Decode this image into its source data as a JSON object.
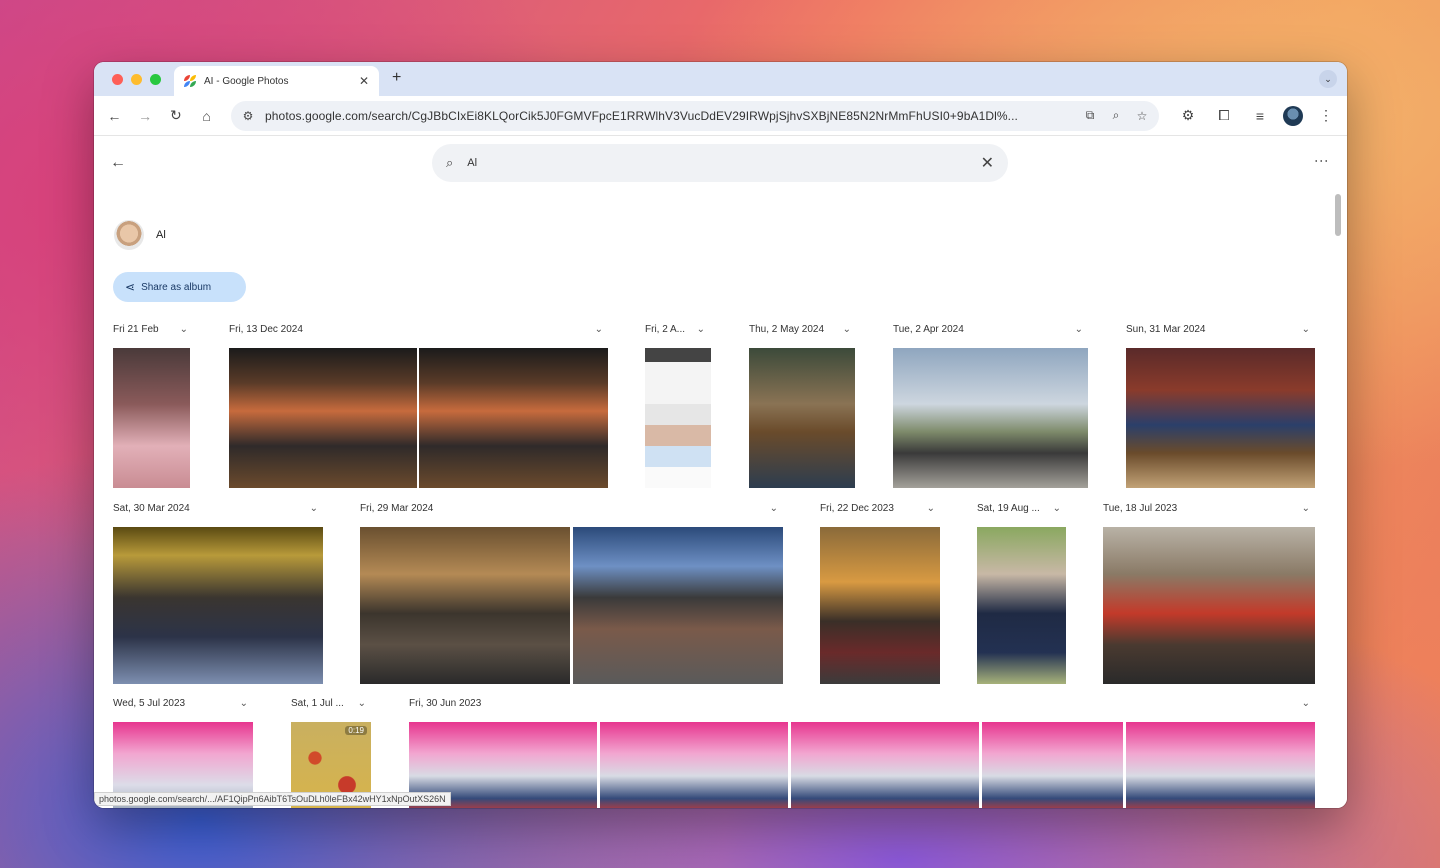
{
  "window": {
    "tab_title": "AI - Google Photos",
    "url": "photos.google.com/search/CgJBbCIxEi8KLQorCik5J0FGMVFpcE1RRWlhV3VucDdEV29IRWpjSjhvSXBjNE85N2NrMmFhUSI0+9bA1Dl%..."
  },
  "photos_app": {
    "search_value": "Al",
    "person_name": "Al",
    "share_label": "Share as album",
    "status_url": "photos.google.com/search/.../AF1QipPn6AibT6TsOuDLh0leFBx42wHY1xNpOutXS26N"
  },
  "sections": [
    {
      "date": "Fri 21 Feb"
    },
    {
      "date": "Fri, 13 Dec 2024"
    },
    {
      "date": "Fri, 2 A..."
    },
    {
      "date": "Thu, 2 May 2024"
    },
    {
      "date": "Tue, 2 Apr 2024"
    },
    {
      "date": "Sun, 31 Mar 2024"
    },
    {
      "date": "Sat, 30 Mar 2024"
    },
    {
      "date": "Fri, 29 Mar 2024"
    },
    {
      "date": "Fri, 22 Dec 2023"
    },
    {
      "date": "Sat, 19 Aug ..."
    },
    {
      "date": "Tue, 18 Jul 2023"
    },
    {
      "date": "Wed, 5 Jul 2023"
    },
    {
      "date": "Sat, 1 Jul ..."
    },
    {
      "date": "Fri, 30 Jun 2023"
    }
  ],
  "video_duration": "0:19",
  "icons": {
    "back": "arrow-left-icon",
    "forward": "arrow-right-icon",
    "reload": "reload-icon",
    "home": "home-icon",
    "search": "search-icon",
    "close": "close-icon",
    "share": "share-icon",
    "more": "more-vert-icon"
  },
  "colors": {
    "accent": "#c8e1fb",
    "tabbar": "#d9e3f5"
  }
}
